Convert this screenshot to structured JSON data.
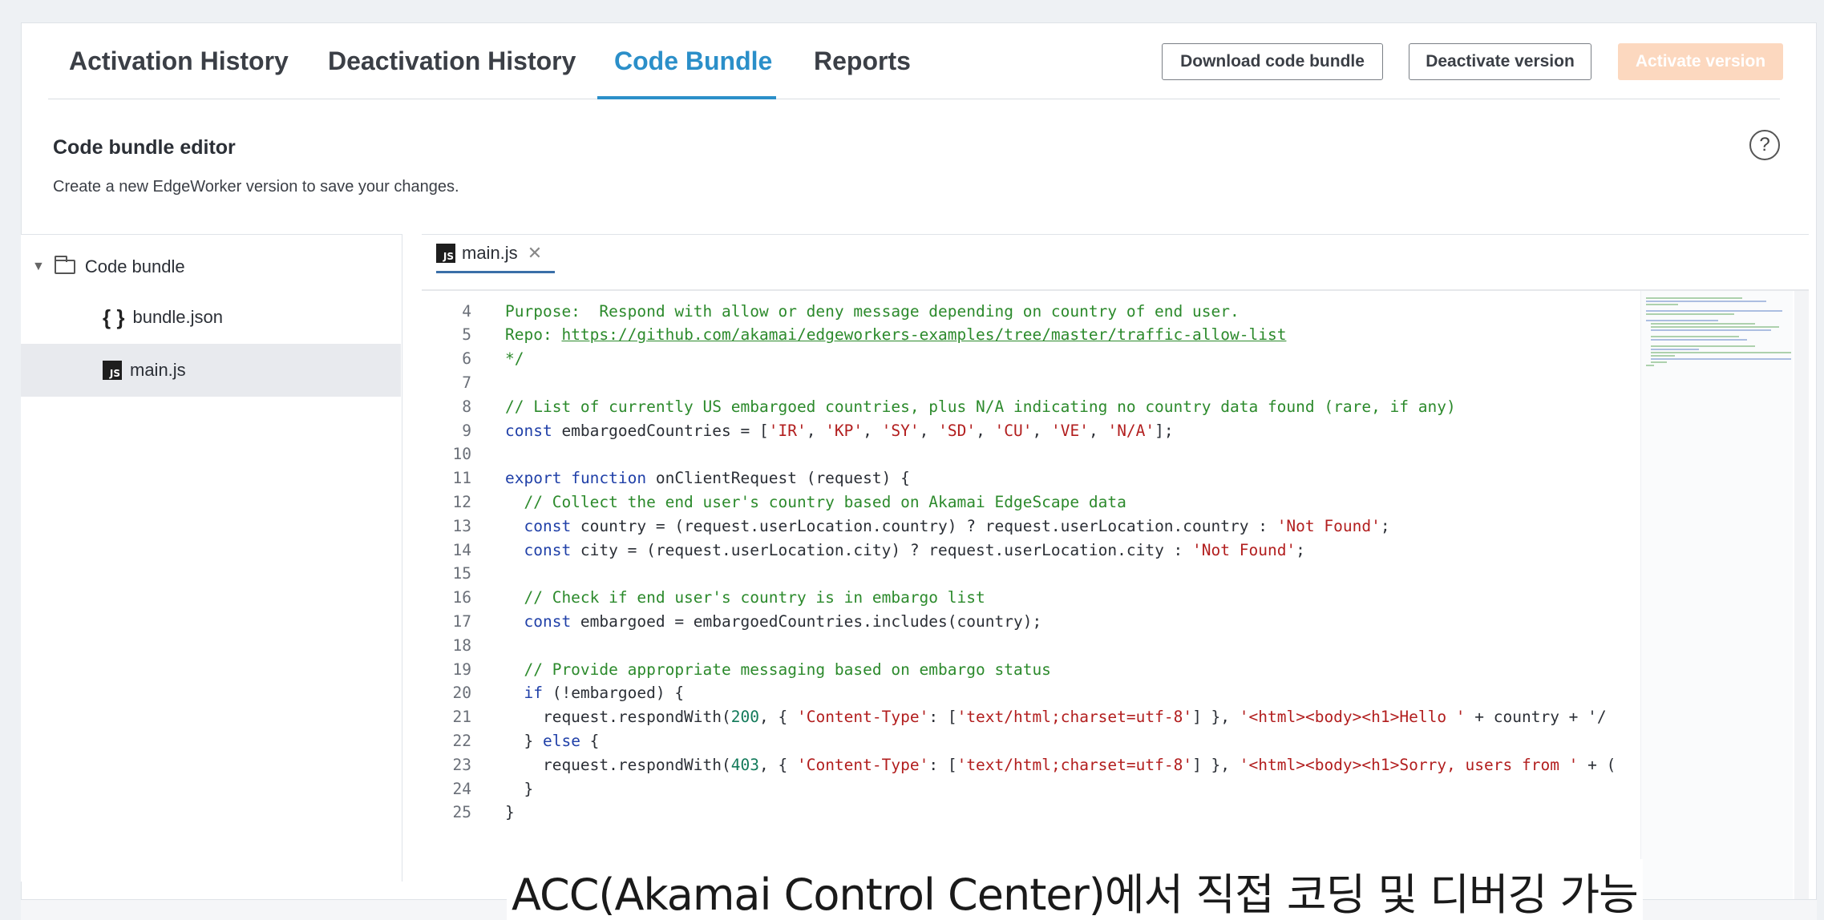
{
  "tabs": [
    {
      "label": "Activation History",
      "active": false
    },
    {
      "label": "Deactivation History",
      "active": false
    },
    {
      "label": "Code Bundle",
      "active": true
    },
    {
      "label": "Reports",
      "active": false
    }
  ],
  "actions": {
    "download": "Download code bundle",
    "deactivate": "Deactivate version",
    "activate": "Activate version"
  },
  "editor_header": {
    "title": "Code bundle editor",
    "subtitle": "Create a new EdgeWorker version to save your changes.",
    "help": "?"
  },
  "explorer": {
    "root": "Code bundle",
    "files": [
      {
        "name": "bundle.json",
        "icon": "braces-icon",
        "selected": false
      },
      {
        "name": "main.js",
        "icon": "js-file-icon",
        "selected": true
      }
    ]
  },
  "open_tab": {
    "name": "main.js",
    "badge": "JS",
    "close": "✕"
  },
  "code": {
    "lines": [
      {
        "n": "4",
        "t": "Purpose:  Respond with allow or deny message depending on country of end user."
      },
      {
        "n": "5",
        "t": "Repo: https://github.com/akamai/edgeworkers-examples/tree/master/traffic-allow-list"
      },
      {
        "n": "6",
        "t": "*/"
      },
      {
        "n": "7",
        "t": ""
      },
      {
        "n": "8",
        "t": "// List of currently US embargoed countries, plus N/A indicating no country data found (rare, if any)"
      },
      {
        "n": "9",
        "t": "const embargoedCountries = ['IR', 'KP', 'SY', 'SD', 'CU', 'VE', 'N/A'];"
      },
      {
        "n": "10",
        "t": ""
      },
      {
        "n": "11",
        "t": "export function onClientRequest (request) {"
      },
      {
        "n": "12",
        "t": "  // Collect the end user's country based on Akamai EdgeScape data"
      },
      {
        "n": "13",
        "t": "  const country = (request.userLocation.country) ? request.userLocation.country : 'Not Found';"
      },
      {
        "n": "14",
        "t": "  const city = (request.userLocation.city) ? request.userLocation.city : 'Not Found';"
      },
      {
        "n": "15",
        "t": ""
      },
      {
        "n": "16",
        "t": "  // Check if end user's country is in embargo list"
      },
      {
        "n": "17",
        "t": "  const embargoed = embargoedCountries.includes(country);"
      },
      {
        "n": "18",
        "t": ""
      },
      {
        "n": "19",
        "t": "  // Provide appropriate messaging based on embargo status"
      },
      {
        "n": "20",
        "t": "  if (!embargoed) {"
      },
      {
        "n": "21",
        "t": "    request.respondWith(200, { 'Content-Type': ['text/html;charset=utf-8'] }, '<html><body><h1>Hello ' + country + '/"
      },
      {
        "n": "22",
        "t": "  } else {"
      },
      {
        "n": "23",
        "t": "    request.respondWith(403, { 'Content-Type': ['text/html;charset=utf-8'] }, '<html><body><h1>Sorry, users from ' + ("
      },
      {
        "n": "24",
        "t": "  }"
      },
      {
        "n": "25",
        "t": "}"
      }
    ]
  },
  "caption": "ACC(Akamai Control Center)에서 직접 코딩 및 디버깅 가능",
  "colors": {
    "accent": "#2b8fc9",
    "activate_disabled": "#fcd8bf",
    "comment": "#2c8a2c",
    "keyword": "#2040a8",
    "string": "#b21e1e",
    "number": "#127a5a"
  }
}
